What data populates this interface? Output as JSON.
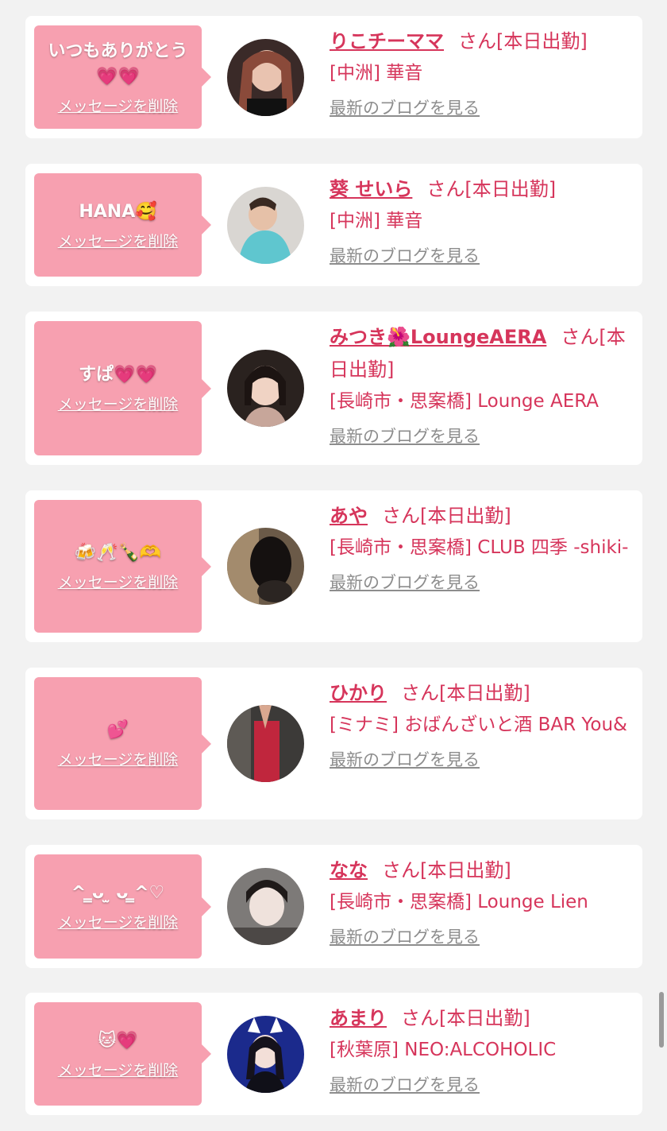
{
  "common": {
    "delete_label": "メッセージを削除",
    "blog_label": "最新のブログを見る",
    "san_label": "さん[本日出勤]"
  },
  "cards": [
    {
      "message": "いつもありがとう💗💗",
      "name": "りこチーママ",
      "shop": "[中洲] 華音"
    },
    {
      "message": "HANA🥰",
      "name": "葵 せいら",
      "shop": "[中洲] 華音"
    },
    {
      "message": "すぱ💗💗",
      "name": "みつき🌺LoungeAERA",
      "shop": "[長崎市・思案橋] Lounge AERA"
    },
    {
      "message": "🍻🥂🍾🫶",
      "name": "あや",
      "shop": "[長崎市・思案橋] CLUB 四季 -shiki-"
    },
    {
      "message": "💕",
      "name": "ひかり",
      "shop": "[ミナミ] おばんざいと酒 BAR You&"
    },
    {
      "message": "^ ̳ᴗ ̫ ᴗ ̳^♡",
      "name": "なな",
      "shop": "[長崎市・思案橋] Lounge Lien"
    },
    {
      "message": "🐱💗",
      "name": "あまり",
      "shop": "[秋葉原] NEO:ALCOHOLIC"
    }
  ],
  "colors": {
    "accent": "#d6355b",
    "bubble": "#f7a0b0",
    "background": "#f2f2f2",
    "muted": "#8d8d8d"
  }
}
